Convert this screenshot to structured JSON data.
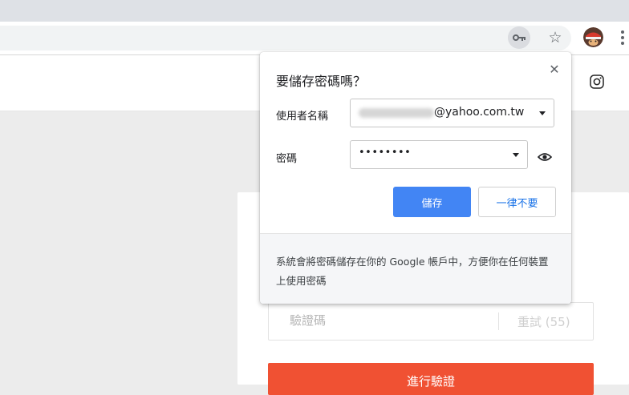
{
  "browser": {
    "star_glyph": "☆",
    "colors": {
      "tabstrip": "#dee1e6",
      "accent": "#4285f4"
    }
  },
  "site": {
    "code_placeholder": "驗證碼",
    "retry_label": "重試 (55)",
    "verify_label": "進行驗證",
    "accent_color": "#f05133"
  },
  "popup": {
    "title": "要儲存密碼嗎？",
    "close_glyph": "✕",
    "username_label": "使用者名稱",
    "username_value": "@yahoo.com.tw",
    "password_label": "密碼",
    "password_value": "••••••••",
    "save_label": "儲存",
    "never_label": "一律不要",
    "footer_text": "系統會將密碼儲存在你的 Google 帳戶中，方便你在任何裝置上使用密碼"
  }
}
